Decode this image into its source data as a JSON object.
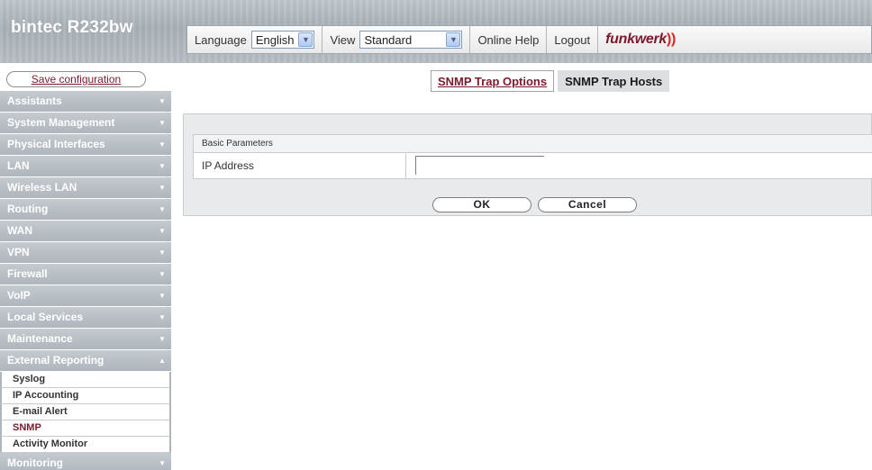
{
  "header": {
    "brand": "bintec R232bw",
    "language_label": "Language",
    "language_value": "English",
    "view_label": "View",
    "view_value": "Standard",
    "online_help": "Online Help",
    "logout": "Logout",
    "logo_text": "funkwerk",
    "logo_waves": "))"
  },
  "sidebar": {
    "save_configuration": "Save configuration",
    "items_top": [
      {
        "label": "Assistants"
      },
      {
        "label": "System Management"
      },
      {
        "label": "Physical Interfaces"
      },
      {
        "label": "LAN"
      },
      {
        "label": "Wireless LAN"
      },
      {
        "label": "Routing"
      },
      {
        "label": "WAN"
      },
      {
        "label": "VPN"
      },
      {
        "label": "Firewall"
      },
      {
        "label": "VoIP"
      },
      {
        "label": "Local Services"
      },
      {
        "label": "Maintenance"
      },
      {
        "label": "External Reporting"
      }
    ],
    "sub_items": [
      {
        "label": "Syslog"
      },
      {
        "label": "IP Accounting"
      },
      {
        "label": "E-mail Alert"
      },
      {
        "label": "SNMP"
      },
      {
        "label": "Activity Monitor"
      }
    ],
    "items_bottom": [
      {
        "label": "Monitoring"
      }
    ],
    "arrow_down": "▼",
    "arrow_up": "▲"
  },
  "main": {
    "tabs": [
      {
        "label": "SNMP Trap Options",
        "active": false
      },
      {
        "label": "SNMP Trap Hosts",
        "active": true
      }
    ],
    "section_title": "Basic Parameters",
    "ip_label": "IP Address",
    "ip_value": "",
    "ok": "OK",
    "cancel": "Cancel"
  },
  "colors": {
    "accent": "#7a1a2c",
    "menu_bg": "#b4bbc2",
    "logo_waves": "#d6261e"
  }
}
